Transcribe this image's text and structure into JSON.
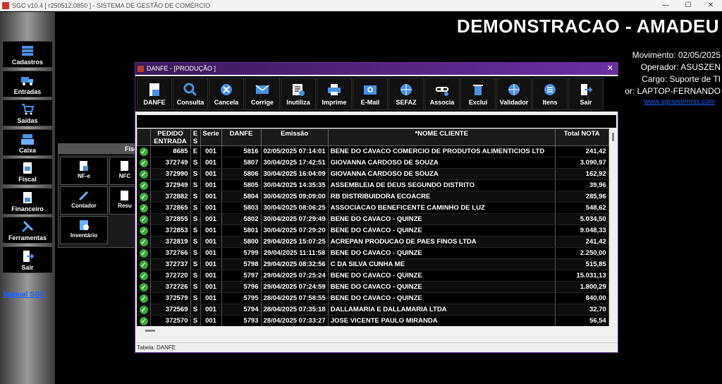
{
  "window": {
    "title": "SGC v10.4 [ r250512.0850 ] - SISTEMA DE GESTÃO DE COMÉRCIO",
    "min": "—",
    "max": "☐",
    "close": "✕"
  },
  "sidebar": {
    "items": [
      {
        "label": "Cadastros",
        "icon": "stack-icon"
      },
      {
        "label": "Entradas",
        "icon": "truck-icon"
      },
      {
        "label": "Saídas",
        "icon": "cart-icon"
      },
      {
        "label": "Caixa",
        "icon": "register-icon"
      },
      {
        "label": "Fiscal",
        "icon": "document-icon"
      },
      {
        "label": "Financeiro",
        "icon": "document-icon"
      },
      {
        "label": "Ferramentas",
        "icon": "tools-icon"
      },
      {
        "label": "Sair",
        "icon": "exit-icon"
      }
    ],
    "manual": "Manual SGC"
  },
  "fiscal_panel": {
    "title": "Fisc",
    "items": [
      "NF-e",
      "NFC",
      "Contador",
      "Resu",
      "Inventário"
    ]
  },
  "header": {
    "title": "DEMONSTRACAO - AMADEU",
    "movimento": "Movimento: 02/05/2025",
    "operador": "Operador: ASUSZEN",
    "cargo": "Cargo: Suporte de TI",
    "computador": "or: LAPTOP-FERNANDO",
    "site": "www.sgcsistemas.com"
  },
  "dialog": {
    "title": "DANFE - [PRODUÇÃO  ]",
    "close": "✕",
    "toolbar": [
      "DANFE",
      "Consulta",
      "Cancela",
      "Corrige",
      "Inutiliza",
      "Imprime",
      "E-Mail",
      "SEFAZ",
      "Associa",
      "Exclui",
      "Validador",
      "Itens",
      "Sair"
    ],
    "columns": [
      "PEDIDO ENTRADA",
      "E S",
      "Serie",
      "DANFE",
      "Emissão",
      "*NOME CLIENTE",
      "Total NOTA"
    ],
    "rows": [
      [
        "8685",
        "E",
        "001",
        "5816",
        "02/05/2025 07:14:01",
        "BENE DO CAVACO COMERCIO DE PRODUTOS ALIMENTICIOS LTD",
        "241,42"
      ],
      [
        "372749",
        "S",
        "001",
        "5807",
        "30/04/2025 17:42:51",
        "GIOVANNA CARDOSO DE SOUZA",
        "3.090,97"
      ],
      [
        "372990",
        "S",
        "001",
        "5806",
        "30/04/2025 16:04:09",
        "GIOVANNA CARDOSO DE SOUZA",
        "162,92"
      ],
      [
        "372949",
        "S",
        "001",
        "5805",
        "30/04/2025 14:35:35",
        "ASSEMBLEIA DE DEUS SEGUNDO DISTRITO",
        "39,96"
      ],
      [
        "372882",
        "S",
        "001",
        "5804",
        "30/04/2025 09:09:00",
        "RB DISTRIBUIDORA ECOACRE",
        "285,96"
      ],
      [
        "372865",
        "S",
        "001",
        "5803",
        "30/04/2025 08:06:25",
        "ASSOCIACAO BENEFICENTE CAMINHO DE LUZ",
        "548,62"
      ],
      [
        "372855",
        "S",
        "001",
        "5802",
        "30/04/2025 07:29:49",
        "BENE DO CAVACO - QUINZE",
        "5.034,50"
      ],
      [
        "372853",
        "S",
        "001",
        "5801",
        "30/04/2025 07:29:20",
        "BENE DO CAVACO - QUINZE",
        "9.048,33"
      ],
      [
        "372819",
        "S",
        "001",
        "5800",
        "29/04/2025 15:07:25",
        "ACREPAN  PRODUCAO DE PAES  FINOS LTDA",
        "241,42"
      ],
      [
        "372766",
        "S",
        "001",
        "5799",
        "29/04/2025 11:11:58",
        "BENE DO CAVACO - QUINZE",
        "2.250,00"
      ],
      [
        "372737",
        "S",
        "001",
        "5798",
        "29/04/2025 08:32:56",
        "C DA SILVA CUNHA ME",
        "515,85"
      ],
      [
        "372720",
        "S",
        "001",
        "5797",
        "29/04/2025 07:25:24",
        "BENE DO CAVACO - QUINZE",
        "15.031,13"
      ],
      [
        "372726",
        "S",
        "001",
        "5796",
        "29/04/2025 07:24:59",
        "BENE DO CAVACO - QUINZE",
        "1.800,29"
      ],
      [
        "372579",
        "S",
        "001",
        "5795",
        "28/04/2025 07:58:55",
        "BENE DO CAVACO - QUINZE",
        "840,00"
      ],
      [
        "372569",
        "S",
        "001",
        "5794",
        "28/04/2025 07:35:18",
        "DALLAMARIA E DALLAMARIA LTDA",
        "32,70"
      ],
      [
        "372570",
        "S",
        "001",
        "5793",
        "28/04/2025 07:33:27",
        "JOSE VICENTE PAULO MIRANDA",
        "56,54"
      ]
    ],
    "status": "Tabela: DANFE"
  },
  "colors": {
    "accent": "#6a2fa0",
    "ok": "#3aa83a",
    "link": "#1e5fff"
  }
}
